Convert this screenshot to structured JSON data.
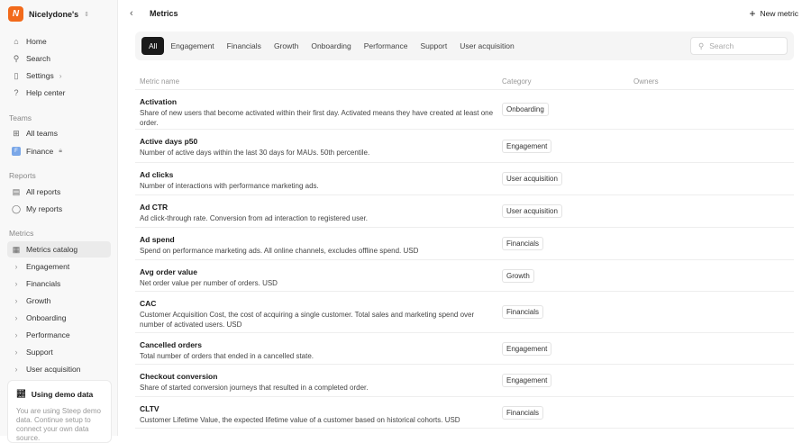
{
  "workspace": {
    "name": "Nicelydone's",
    "logo": "N"
  },
  "nav": [
    {
      "label": "Home",
      "icon": "home-icon",
      "g": "⌂"
    },
    {
      "label": "Search",
      "icon": "search-icon",
      "g": "⚲"
    },
    {
      "label": "Settings",
      "icon": "settings-icon",
      "g": "▯"
    },
    {
      "label": "Help center",
      "icon": "help-icon",
      "g": "?"
    }
  ],
  "teams": {
    "title": "Teams",
    "all": "All teams",
    "finance": "Finance",
    "finance_badge": "F"
  },
  "reports": {
    "title": "Reports",
    "items": [
      "All reports",
      "My reports"
    ]
  },
  "metrics": {
    "title": "Metrics",
    "catalog": "Metrics catalog",
    "items": [
      "Engagement",
      "Financials",
      "Growth",
      "Onboarding",
      "Performance",
      "Support",
      "User acquisition"
    ]
  },
  "demo": {
    "title": "Using demo data",
    "desc": "You are using Steep demo data. Continue setup to connect your own data source."
  },
  "header": {
    "title": "Metrics",
    "new_metric": "New metric"
  },
  "tabs": [
    "All",
    "Engagement",
    "Financials",
    "Growth",
    "Onboarding",
    "Performance",
    "Support",
    "User acquisition"
  ],
  "search": {
    "placeholder": "Search"
  },
  "columns": {
    "name": "Metric name",
    "category": "Category",
    "owners": "Owners"
  },
  "rows": [
    {
      "name": "Activation",
      "desc": "Share of new users that become activated within their first day. Activated means they have created at least one order.",
      "category": "Onboarding"
    },
    {
      "name": "Active days p50",
      "desc": "Number of active days within the last 30 days for MAUs. 50th percentile.",
      "category": "Engagement"
    },
    {
      "name": "Ad clicks",
      "desc": "Number of interactions with performance marketing ads.",
      "category": "User acquisition"
    },
    {
      "name": "Ad CTR",
      "desc": "Ad click-through rate. Conversion from ad interaction to registered user.",
      "category": "User acquisition"
    },
    {
      "name": "Ad spend",
      "desc": "Spend on performance marketing ads. All online channels, excludes offline spend. USD",
      "category": "Financials"
    },
    {
      "name": "Avg order value",
      "desc": "Net order value per number of orders. USD",
      "category": "Growth"
    },
    {
      "name": "CAC",
      "desc": "Customer Acquisition Cost, the cost of acquiring a single customer. Total sales and marketing spend over number of activated users. USD",
      "category": "Financials"
    },
    {
      "name": "Cancelled orders",
      "desc": "Total number of orders that ended in a cancelled state.",
      "category": "Engagement"
    },
    {
      "name": "Checkout conversion",
      "desc": "Share of started conversion journeys that resulted in a completed order.",
      "category": "Engagement"
    },
    {
      "name": "CLTV",
      "desc": "Customer Lifetime Value, the expected lifetime value of a customer based on historical cohorts. USD",
      "category": "Financials"
    }
  ]
}
